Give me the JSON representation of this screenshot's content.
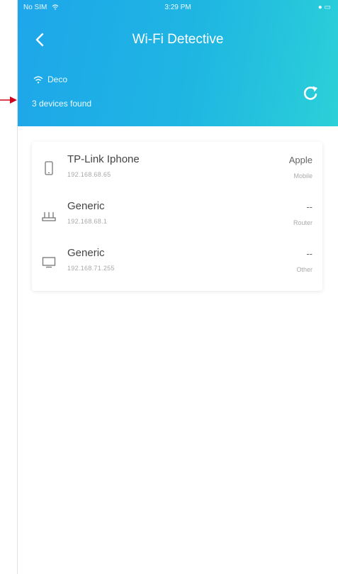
{
  "status_bar": {
    "carrier": "No SIM",
    "time": "3:29 PM",
    "battery": "● ▭"
  },
  "nav": {
    "title": "Wi-Fi Detective",
    "back_icon": "chevron-left-icon"
  },
  "network": {
    "name": "Deco",
    "found_text": "3 devices found",
    "wifi_icon": "wifi-icon",
    "refresh_icon": "refresh-icon"
  },
  "devices": [
    {
      "name": "TP-Link Iphone",
      "ip": "192.168.68.65",
      "vendor": "Apple",
      "type": "Mobile",
      "icon": "phone-icon"
    },
    {
      "name": "Generic",
      "ip": "192.168.68.1",
      "vendor": "--",
      "type": "Router",
      "icon": "router-icon"
    },
    {
      "name": "Generic",
      "ip": "192.168.71.255",
      "vendor": "--",
      "type": "Other",
      "icon": "monitor-icon"
    }
  ],
  "colors": {
    "header_start": "#1ea6ea",
    "header_end": "#2bd0d8",
    "annotation_arrow": "#d0021b"
  }
}
